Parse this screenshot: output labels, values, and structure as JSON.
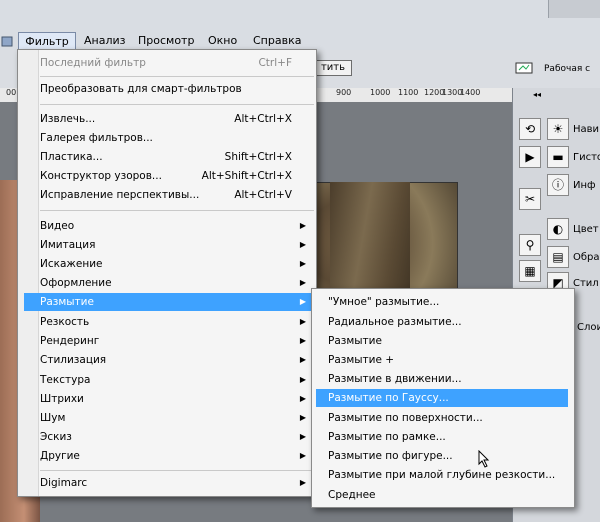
{
  "menubar": {
    "items": [
      "Фильтр",
      "Анализ",
      "Просмотр",
      "Окно",
      "Справка"
    ]
  },
  "options": {
    "apply_label": "тить",
    "workspace_label": "Рабочая с"
  },
  "ruler": {
    "ticks": [
      "00",
      "900",
      "1000",
      "1100",
      "1200",
      "1300",
      "1400"
    ]
  },
  "filter_menu": {
    "items": [
      {
        "label": "Последний фильтр",
        "shortcut": "Ctrl+F",
        "disabled": true
      },
      {
        "label": "Преобразовать для смарт-фильтров"
      },
      {
        "label": "Извлечь...",
        "shortcut": "Alt+Ctrl+X"
      },
      {
        "label": "Галерея фильтров..."
      },
      {
        "label": "Пластика...",
        "shortcut": "Shift+Ctrl+X"
      },
      {
        "label": "Конструктор узоров...",
        "shortcut": "Alt+Shift+Ctrl+X"
      },
      {
        "label": "Исправление перспективы...",
        "shortcut": "Alt+Ctrl+V"
      },
      {
        "label": "Видео"
      },
      {
        "label": "Имитация"
      },
      {
        "label": "Искажение"
      },
      {
        "label": "Оформление"
      },
      {
        "label": "Размытие",
        "highlighted": true
      },
      {
        "label": "Резкость"
      },
      {
        "label": "Рендеринг"
      },
      {
        "label": "Стилизация"
      },
      {
        "label": "Текстура"
      },
      {
        "label": "Штрихи"
      },
      {
        "label": "Шум"
      },
      {
        "label": "Эскиз"
      },
      {
        "label": "Другие"
      },
      {
        "label": "Digimarc"
      }
    ]
  },
  "blur_menu": {
    "items": [
      {
        "label": "\"Умное\" размытие..."
      },
      {
        "label": "Радиальное размытие..."
      },
      {
        "label": "Размытие"
      },
      {
        "label": "Размытие +"
      },
      {
        "label": "Размытие в движении..."
      },
      {
        "label": "Размытие по Гауссу...",
        "highlighted": true
      },
      {
        "label": "Размытие по поверхности..."
      },
      {
        "label": "Размытие по рамке..."
      },
      {
        "label": "Размытие по фигуре..."
      },
      {
        "label": "Размытие при малой глубине резкости..."
      },
      {
        "label": "Среднее"
      }
    ]
  },
  "right_panel": {
    "labels": [
      "Нави",
      "Гисто",
      "Инф",
      "Цвет",
      "Обра",
      "Стил",
      "Слои"
    ]
  },
  "colors": {
    "highlight": "#3ea2ff",
    "menu_bg": "#f5f5f5"
  }
}
